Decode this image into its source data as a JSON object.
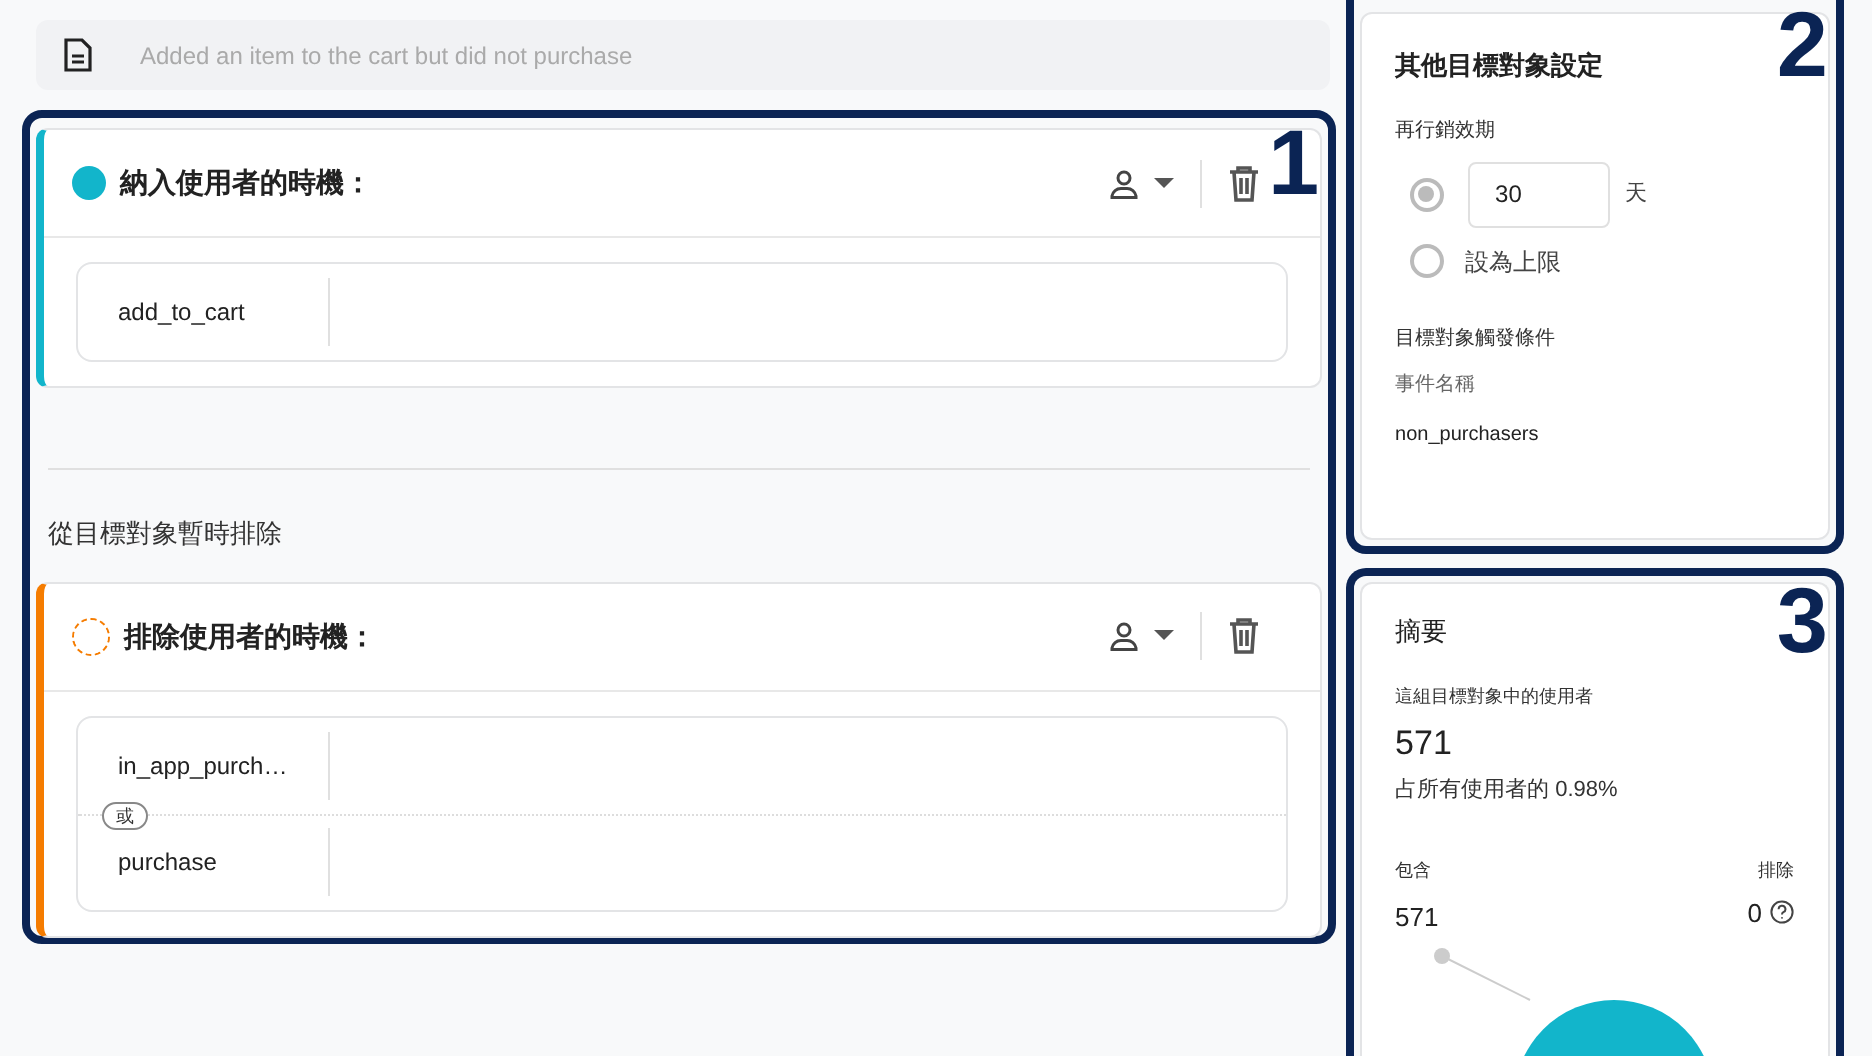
{
  "template": {
    "text": "Added an item to the cart but did not purchase"
  },
  "groups": [
    {
      "kind": "include",
      "title": "納入使用者的時機：",
      "conditions": [
        {
          "event": "add_to_cart"
        }
      ]
    },
    {
      "kind": "exclude",
      "heading": "從目標對象暫時排除",
      "title": "排除使用者的時機：",
      "joiner": "或",
      "conditions": [
        {
          "event": "in_app_purch…"
        },
        {
          "event": "purchase"
        }
      ]
    }
  ],
  "settings": {
    "title": "其他目標對象設定",
    "duration_label": "再行銷效期",
    "options": [
      {
        "kind": "duration",
        "selected": true,
        "value": "30",
        "unit": "天"
      },
      {
        "kind": "limit",
        "selected": false,
        "label": "設為上限"
      }
    ],
    "trigger_label": "目標對象觸發條件",
    "event_label": "事件名稱",
    "event_value": "non_purchasers"
  },
  "summary": {
    "title": "摘要",
    "users_label": "這組目標對象中的使用者",
    "users_value": "571",
    "share": "占所有使用者的 0.98%",
    "include_label": "包含",
    "include_value": "571",
    "exclude_label": "排除",
    "exclude_value": "0"
  },
  "annotations": [
    "1",
    "2",
    "3"
  ]
}
